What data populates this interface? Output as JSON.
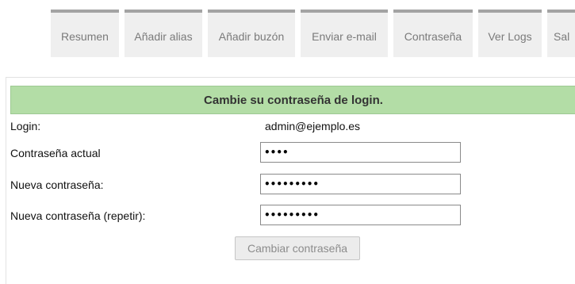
{
  "nav": {
    "tabs": [
      {
        "label": "Resumen"
      },
      {
        "label": "Añadir alias"
      },
      {
        "label": "Añadir buzón"
      },
      {
        "label": "Enviar e-mail"
      },
      {
        "label": "Contraseña"
      },
      {
        "label": "Ver Logs"
      },
      {
        "label": "Sal"
      }
    ]
  },
  "form": {
    "title": "Cambie su contraseña de login.",
    "login_label": "Login:",
    "login_value": "admin@ejemplo.es",
    "current_password_label": "Contraseña actual",
    "current_password_value": "••••",
    "new_password_label": "Nueva contraseña:",
    "new_password_value": "•••••••••",
    "repeat_password_label": "Nueva contraseña (repetir):",
    "repeat_password_value": "•••••••••",
    "submit_label": "Cambiar contraseña"
  },
  "colors": {
    "header_bg": "#b3dda6",
    "tab_bg": "#efefef",
    "tab_border": "#a3a3a3"
  }
}
